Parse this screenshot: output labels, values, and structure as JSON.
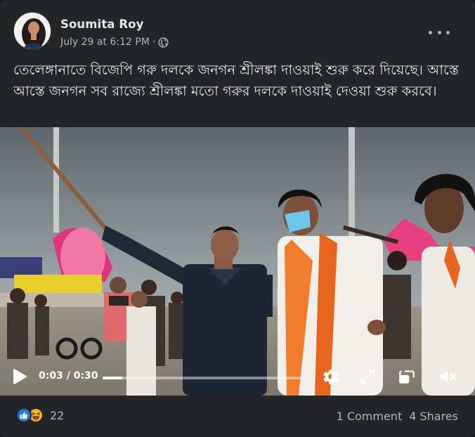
{
  "post": {
    "author": "Soumita Roy",
    "date": "July 29 at 6:12 PM",
    "separator": "·",
    "privacy_icon": "globe-icon",
    "more_icon": "more-options-icon",
    "text": "তেলেঙ্গানাতে বিজেপি গরু দলকে জনগন শ্রীলঙ্কা দাওয়াই শুরু করে দিয়েছে। আস্তে আস্তে জনগন সব রাজ্যে শ্রীলঙ্কা মতো গরুর দলকে দাওয়াই দেওয়া শুরু করবে।"
  },
  "video": {
    "current_time": "0:03",
    "time_separator": " / ",
    "duration": "0:30",
    "progress_fraction": 0.1,
    "icons": [
      "play-icon",
      "settings-icon",
      "fullscreen-icon",
      "picture-in-picture-icon",
      "volume-muted-icon"
    ]
  },
  "footer": {
    "reaction_icons": [
      "like-reaction-icon",
      "haha-reaction-icon"
    ],
    "reaction_count": "22",
    "comments": "1 Comment",
    "shares": "4 Shares"
  },
  "colors": {
    "card_bg": "#242526",
    "text_primary": "#e4e6eb",
    "text_secondary": "#b0b3b8",
    "like_blue": "#1877f2",
    "haha_yellow": "#f7b125"
  }
}
